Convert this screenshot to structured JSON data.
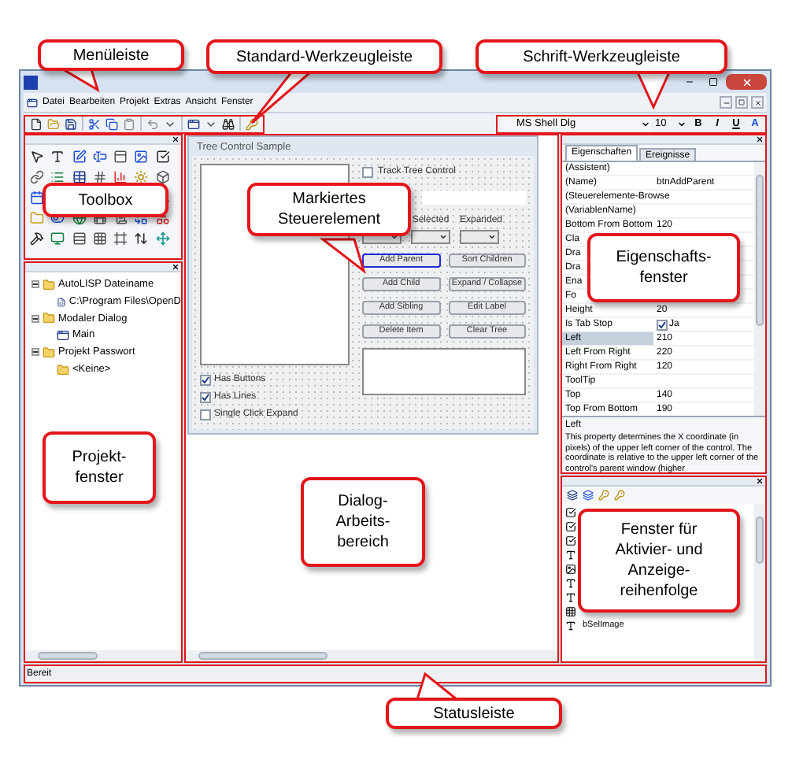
{
  "menu_bar": {
    "items": [
      "Datei",
      "Bearbeiten",
      "Projekt",
      "Extras",
      "Ansicht",
      "Fenster"
    ]
  },
  "font_toolbar": {
    "font": "MS Shell Dlg",
    "size": "10",
    "buttons": [
      "B",
      "I",
      "U",
      "A"
    ]
  },
  "project_tree": [
    {
      "label": "AutoLISP Dateiname",
      "children": [
        {
          "label": "C:\\Program Files\\OpenD",
          "kind": "file"
        }
      ]
    },
    {
      "label": "Modaler Dialog",
      "children": [
        {
          "label": "Main",
          "kind": "form"
        }
      ]
    },
    {
      "label": "Projekt Passwort",
      "children": [
        {
          "label": "<Keine>",
          "kind": "folder"
        }
      ]
    }
  ],
  "dialog": {
    "title": "Tree Control Sample",
    "track_checkbox": {
      "label": "Track Tree Control",
      "checked": false
    },
    "combo_labels": [
      "Selected",
      "Expanded"
    ],
    "buttons": [
      {
        "label": "Add Parent",
        "selected": true
      },
      {
        "label": "Sort Children",
        "selected": false
      },
      {
        "label": "Add Child",
        "selected": false
      },
      {
        "label": "Expand / Collapse",
        "selected": false
      },
      {
        "label": "Add Sibling",
        "selected": false
      },
      {
        "label": "Edit Label",
        "selected": false
      },
      {
        "label": "Delete Item",
        "selected": false
      },
      {
        "label": "Clear Tree",
        "selected": false
      }
    ],
    "checkboxes": [
      {
        "label": "Has Buttons",
        "checked": true
      },
      {
        "label": "Has Lines",
        "checked": true
      },
      {
        "label": "Single Click Expand",
        "checked": false
      }
    ]
  },
  "properties": {
    "tabs": [
      {
        "label": "Eigenschaften",
        "selected": true
      },
      {
        "label": "Ereignisse",
        "selected": false
      }
    ],
    "rows": [
      {
        "name": "(Assistent)",
        "selected": false
      },
      {
        "name": "(Name)",
        "value": "btnAddParent",
        "selected": false
      },
      {
        "name": "(Steuerelemente-Browse",
        "selected": false
      },
      {
        "name": "(VariablenName)",
        "selected": false
      },
      {
        "name": "Bottom From Bottom",
        "value": "120",
        "selected": false
      },
      {
        "name": "Cla",
        "selected": false
      },
      {
        "name": "Dra",
        "selected": false
      },
      {
        "name": "Dra",
        "selected": false
      },
      {
        "name": "Ena",
        "selected": false
      },
      {
        "name": "Fo",
        "selected": false
      },
      {
        "name": "Height",
        "value": "20",
        "selected": false
      },
      {
        "name": "Is Tab Stop",
        "value": "Ja",
        "checked": true,
        "selected": false
      },
      {
        "name": "Left",
        "value": "210",
        "selected": true
      },
      {
        "name": "Left From Right",
        "value": "220",
        "selected": false
      },
      {
        "name": "Right From Right",
        "value": "120",
        "selected": false
      },
      {
        "name": "ToolTip",
        "selected": false
      },
      {
        "name": "Top",
        "value": "140",
        "selected": false
      },
      {
        "name": "Top From Bottom",
        "value": "190",
        "selected": false
      }
    ],
    "description": {
      "title": "Left",
      "text": "This property determines the X coordinate (in pixels) of the upper left corner of the control. The coordinate is relative to the upper left corner of the control's parent window (higher"
    }
  },
  "order_list": [
    {
      "kind": "checkbox"
    },
    {
      "kind": "checkbox"
    },
    {
      "kind": "checkbox"
    },
    {
      "kind": "text"
    },
    {
      "kind": "image"
    },
    {
      "kind": "text"
    },
    {
      "kind": "text"
    },
    {
      "kind": "grid"
    },
    {
      "kind": "text",
      "name": "bSelImage"
    }
  ],
  "status_bar": {
    "text": "Bereit"
  },
  "callouts": [
    {
      "text": "Menüleiste"
    },
    {
      "text": "Standard-Werkzeugleiste"
    },
    {
      "text": "Schrift-Werkzeugleiste"
    },
    {
      "text": "Toolbox"
    },
    {
      "text": "Markiertes\nSteuerelement"
    },
    {
      "text": "Eigenschafts-\nfenster"
    },
    {
      "text": "Projekt-\nfenster"
    },
    {
      "text": "Dialog-\nArbeits-\nbereich"
    },
    {
      "text": "Fenster für\nAktivier- und\nAnzeige-\nreihenfolge"
    },
    {
      "text": "Statusleiste"
    }
  ]
}
